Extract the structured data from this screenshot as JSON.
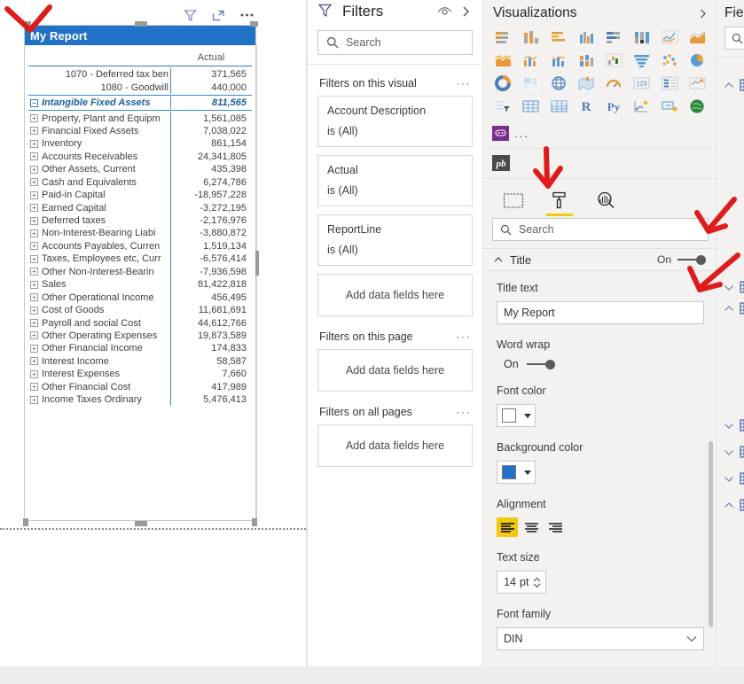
{
  "visual": {
    "title": "My Report",
    "toolbar": [
      {
        "name": "filter-icon",
        "label": "Filters"
      },
      {
        "name": "focus-mode-icon",
        "label": "Focus mode"
      },
      {
        "name": "more-options-icon",
        "label": "More options"
      }
    ],
    "matrix": {
      "value_header": "Actual",
      "rows": [
        {
          "label": "1070 - Deferred tax ben",
          "value": "371,565",
          "expand": "plus",
          "type": "detail"
        },
        {
          "label": "1080 - Goodwill",
          "value": "440,000",
          "expand": "plus",
          "type": "detail"
        },
        {
          "label": "Intangible Fixed Assets",
          "value": "811,565",
          "expand": "minus",
          "type": "subtotal"
        },
        {
          "label": "Property, Plant and Equipm",
          "value": "1,561,085",
          "expand": "plus",
          "type": "group"
        },
        {
          "label": "Financial Fixed Assets",
          "value": "7,038,022",
          "expand": "plus",
          "type": "group"
        },
        {
          "label": "Inventory",
          "value": "861,154",
          "expand": "plus",
          "type": "group"
        },
        {
          "label": "Accounts Receivables",
          "value": "24,341,805",
          "expand": "plus",
          "type": "group"
        },
        {
          "label": "Other Assets, Current",
          "value": "435,398",
          "expand": "plus",
          "type": "group"
        },
        {
          "label": "Cash and Equivalents",
          "value": "6,274,786",
          "expand": "plus",
          "type": "group"
        },
        {
          "label": "Paid-in Capital",
          "value": "-18,957,228",
          "expand": "plus",
          "type": "group"
        },
        {
          "label": "Earned Capital",
          "value": "-3,272,195",
          "expand": "plus",
          "type": "group"
        },
        {
          "label": "Deferred taxes",
          "value": "-2,176,976",
          "expand": "plus",
          "type": "group"
        },
        {
          "label": "Non-Interest-Bearing Liabi",
          "value": "-3,880,872",
          "expand": "plus",
          "type": "group"
        },
        {
          "label": "Accounts Payables, Curren",
          "value": "1,519,134",
          "expand": "plus",
          "type": "group"
        },
        {
          "label": "Taxes, Employees etc, Curr",
          "value": "-6,576,414",
          "expand": "plus",
          "type": "group"
        },
        {
          "label": "Other Non-Interest-Bearin",
          "value": "-7,936,598",
          "expand": "plus",
          "type": "group"
        },
        {
          "label": "Sales",
          "value": "81,422,818",
          "expand": "plus",
          "type": "group"
        },
        {
          "label": "Other Operational Income",
          "value": "456,495",
          "expand": "plus",
          "type": "group"
        },
        {
          "label": "Cost of Goods",
          "value": "11,681,691",
          "expand": "plus",
          "type": "group"
        },
        {
          "label": "Payroll and social Cost",
          "value": "44,612,766",
          "expand": "plus",
          "type": "group"
        },
        {
          "label": "Other Operating Expenses",
          "value": "19,873,589",
          "expand": "plus",
          "type": "group"
        },
        {
          "label": "Other Financial Income",
          "value": "174,833",
          "expand": "plus",
          "type": "group"
        },
        {
          "label": "Interest Income",
          "value": "58,587",
          "expand": "plus",
          "type": "group"
        },
        {
          "label": "Interest Expenses",
          "value": "7,660",
          "expand": "plus",
          "type": "group"
        },
        {
          "label": "Other Financial Cost",
          "value": "417,989",
          "expand": "plus",
          "type": "group"
        },
        {
          "label": "Income Taxes Ordinary",
          "value": "5,476,413",
          "expand": "plus",
          "type": "group"
        }
      ]
    }
  },
  "filters_pane": {
    "title": "Filters",
    "search_placeholder": "Search",
    "groups": [
      {
        "heading": "Filters on this visual",
        "cards": [
          {
            "field": "Account Description",
            "condition": "is (All)"
          },
          {
            "field": "Actual",
            "condition": "is (All)"
          },
          {
            "field": "ReportLine",
            "condition": "is (All)"
          }
        ],
        "dropzone": "Add data fields here"
      },
      {
        "heading": "Filters on this page",
        "cards": [],
        "dropzone": "Add data fields here"
      },
      {
        "heading": "Filters on all pages",
        "cards": [],
        "dropzone": "Add data fields here"
      }
    ]
  },
  "visualizations_pane": {
    "title": "Visualizations",
    "gallery": [
      "stacked-bar-chart-icon",
      "stacked-column-chart-icon",
      "clustered-bar-chart-icon",
      "clustered-column-chart-icon",
      "hundred-percent-stacked-bar-chart-icon",
      "hundred-percent-stacked-column-chart-icon",
      "line-chart-icon",
      "area-chart-icon",
      "stacked-area-chart-icon",
      "line-and-stacked-column-chart-icon",
      "line-and-clustered-column-chart-icon",
      "ribbon-chart-icon",
      "waterfall-chart-icon",
      "funnel-chart-icon",
      "scatter-chart-icon",
      "pie-chart-icon",
      "donut-chart-icon",
      "treemap-icon",
      "map-icon",
      "filled-map-icon",
      "gauge-icon",
      "card-icon",
      "multi-row-card-icon",
      "kpi-icon",
      "slicer-icon",
      "table-icon",
      "matrix-icon",
      "r-script-visual-icon",
      "python-visual-icon",
      "key-influencers-icon",
      "decomposition-tree-icon",
      "arcgis-map-icon"
    ],
    "custom_visuals": [
      "inforiver-visual-icon"
    ],
    "more_label": "...",
    "marketplace_icon": "pb-custom-visual-icon",
    "format_tabs": [
      {
        "name": "fields-tab",
        "icon": "fields-pane-icon",
        "active": false
      },
      {
        "name": "format-tab",
        "icon": "paint-roller-icon",
        "active": true
      },
      {
        "name": "analytics-tab",
        "icon": "magnifier-analytics-icon",
        "active": false
      }
    ],
    "format_search_placeholder": "Search",
    "title_section": {
      "name": "Title",
      "toggle_label": "On",
      "toggle_state": "on",
      "fields": {
        "title_text_label": "Title text",
        "title_text_value": "My Report",
        "word_wrap_label": "Word wrap",
        "word_wrap_state": "On",
        "font_color_label": "Font color",
        "font_color_value": "#FFFFFF",
        "background_color_label": "Background color",
        "background_color_value": "#2171C7",
        "alignment_label": "Alignment",
        "alignment_options": [
          "left",
          "center",
          "right"
        ],
        "alignment_selected": "left",
        "text_size_label": "Text size",
        "text_size_value": "14",
        "text_size_unit": "pt",
        "font_family_label": "Font family",
        "font_family_value": "DIN"
      }
    }
  },
  "fields_pane": {
    "title": "Fie",
    "search_placeholder": ""
  },
  "colors": {
    "accent_blue": "#2171C7",
    "highlight_yellow": "#F2C811",
    "pane_bg": "#F3F2F1",
    "annotation_red": "#E01B1B"
  }
}
